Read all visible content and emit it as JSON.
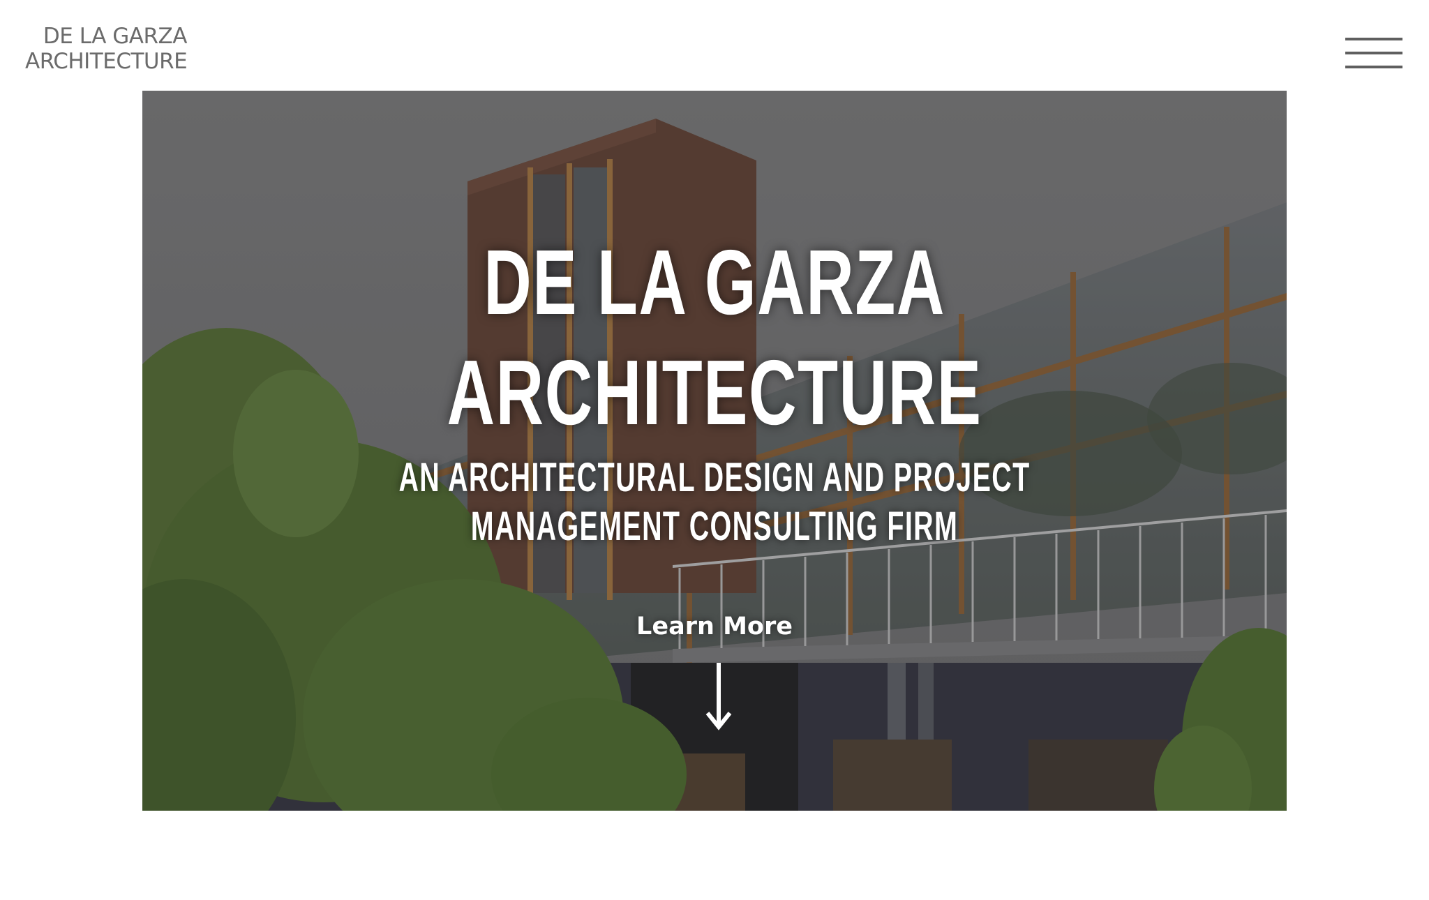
{
  "header": {
    "logo_line1": "DE LA GARZA",
    "logo_line2": "ARCHITECTURE",
    "menu_icon": "hamburger-menu-icon"
  },
  "hero": {
    "title_line1": "DE LA GARZA",
    "title_line2": "ARCHITECTURE",
    "subtitle_line1": "AN ARCHITECTURAL DESIGN AND PROJECT",
    "subtitle_line2": "MANAGEMENT CONSULTING FIRM",
    "cta_label": "Learn More",
    "cta_icon": "arrow-down-icon",
    "background_image": "building-photo"
  },
  "colors": {
    "logo_text": "#6b6b6b",
    "menu_bars": "#5f5f5f",
    "hero_text": "#ffffff",
    "page_background": "#ffffff"
  }
}
